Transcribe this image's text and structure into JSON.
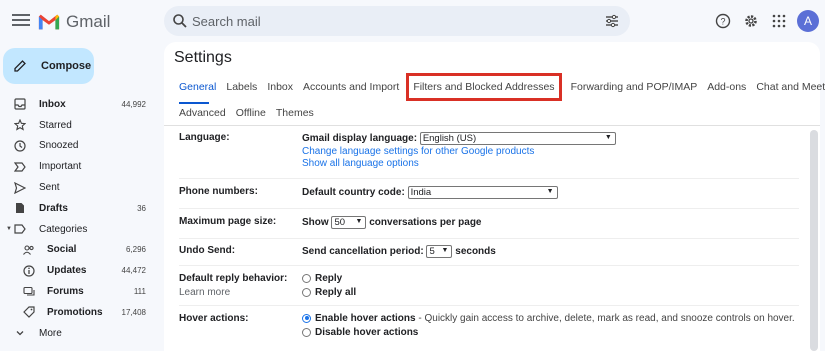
{
  "app": {
    "name": "Gmail"
  },
  "search": {
    "placeholder": "Search mail"
  },
  "user": {
    "avatar_initial": "A"
  },
  "sidebar": {
    "compose_label": "Compose",
    "items": [
      {
        "label": "Inbox",
        "count": "44,992",
        "icon": "inbox-icon",
        "bold": true
      },
      {
        "label": "Starred",
        "count": "",
        "icon": "star-icon",
        "bold": false
      },
      {
        "label": "Snoozed",
        "count": "",
        "icon": "clock-icon",
        "bold": false
      },
      {
        "label": "Important",
        "count": "",
        "icon": "important-icon",
        "bold": false
      },
      {
        "label": "Sent",
        "count": "",
        "icon": "send-icon",
        "bold": false
      },
      {
        "label": "Drafts",
        "count": "36",
        "icon": "draft-icon",
        "bold": true
      },
      {
        "label": "Categories",
        "count": "",
        "icon": "label-icon",
        "bold": false
      },
      {
        "label": "Social",
        "count": "6,296",
        "icon": "people-icon",
        "bold": true
      },
      {
        "label": "Updates",
        "count": "44,472",
        "icon": "info-icon",
        "bold": true
      },
      {
        "label": "Forums",
        "count": "111",
        "icon": "forum-icon",
        "bold": true
      },
      {
        "label": "Promotions",
        "count": "17,408",
        "icon": "tag-icon",
        "bold": true
      },
      {
        "label": "More",
        "count": "",
        "icon": "chevron-down-icon",
        "bold": false
      }
    ]
  },
  "settings": {
    "title": "Settings",
    "tabs_row1": [
      "General",
      "Labels",
      "Inbox",
      "Accounts and Import",
      "Filters and Blocked Addresses",
      "Forwarding and POP/IMAP",
      "Add-ons",
      "Chat and Meet"
    ],
    "tabs_row2": [
      "Advanced",
      "Offline",
      "Themes"
    ],
    "active_tab": "General",
    "highlighted_tab": "Filters and Blocked Addresses",
    "language": {
      "label": "Language:",
      "display_label": "Gmail display language:",
      "value": "English (US)",
      "link1": "Change language settings for other Google products",
      "link2": "Show all language options"
    },
    "phone": {
      "label": "Phone numbers:",
      "country_label": "Default country code:",
      "value": "India"
    },
    "page_size": {
      "label": "Maximum page size:",
      "show": "Show",
      "value": "50",
      "suffix": "conversations per page"
    },
    "undo": {
      "label": "Undo Send:",
      "period_label": "Send cancellation period:",
      "value": "5",
      "suffix": "seconds"
    },
    "reply": {
      "label": "Default reply behavior:",
      "learn_more": "Learn more",
      "option1": "Reply",
      "option2": "Reply all"
    },
    "hover": {
      "label": "Hover actions:",
      "option1": "Enable hover actions",
      "option1_desc": "- Quickly gain access to archive, delete, mark as read, and snooze controls on hover.",
      "option2": "Disable hover actions"
    }
  },
  "colors": {
    "accent": "#0b57d0",
    "compose_bg": "#c2e7ff",
    "highlight": "#d93025"
  }
}
